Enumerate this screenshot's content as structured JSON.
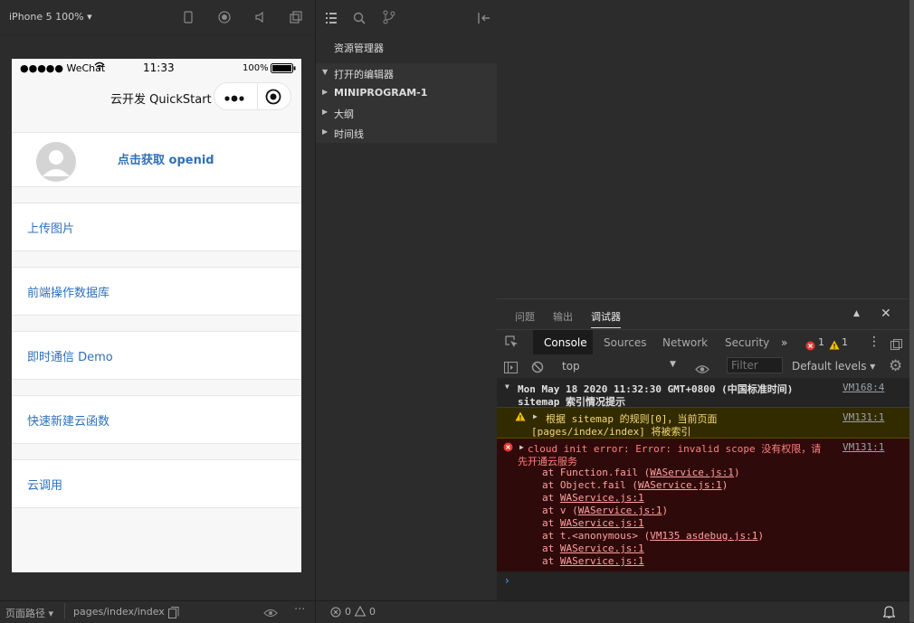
{
  "simulator": {
    "device": "iPhone 5 100% ▾",
    "status": {
      "carrier": "●●●●● WeChat",
      "time": "11:33",
      "battery": "100%"
    },
    "nav_title": "云开发 QuickStart",
    "openid_label": "点击获取 openid",
    "menu": [
      "上传图片",
      "前端操作数据库",
      "即时通信 Demo",
      "快速新建云函数",
      "云调用"
    ]
  },
  "explorer": {
    "title": "资源管理器",
    "items": [
      "打开的编辑器",
      "MINIPROGRAM-1",
      "大纲",
      "时间线"
    ]
  },
  "panel": {
    "tabs": [
      "问题",
      "输出",
      "调试器"
    ],
    "devtools_tabs": [
      "Console",
      "Sources",
      "Network",
      "Security"
    ],
    "error_count": "1",
    "warning_count": "1",
    "context": "top",
    "filter_placeholder": "Filter",
    "levels": "Default levels ▾"
  },
  "log": {
    "group_header": "Mon May 18 2020 11:32:30 GMT+0800 (中国标准时间)",
    "group_subtitle": "sitemap 索引情况提示",
    "group_source": "VM168:4",
    "warn_line1": "根据 sitemap 的规则[0]，当前页面",
    "warn_line2": "[pages/index/index] 将被索引",
    "warn_source": "VM131:1",
    "error_line1": "cloud init error:  Error: invalid scope 没有权限，请",
    "error_line2": "先开通云服务",
    "error_source": "VM131:1",
    "stack": [
      {
        "prefix": "at Function.fail (",
        "file": "WAService.js:1",
        "suffix": ")"
      },
      {
        "prefix": "at Object.fail (",
        "file": "WAService.js:1",
        "suffix": ")"
      },
      {
        "prefix": "at ",
        "file": "WAService.js:1",
        "suffix": ""
      },
      {
        "prefix": "at v (",
        "file": "WAService.js:1",
        "suffix": ")"
      },
      {
        "prefix": "at ",
        "file": "WAService.js:1",
        "suffix": ""
      },
      {
        "prefix": "at t.<anonymous> (",
        "file": "VM135 asdebug.js:1",
        "suffix": ")"
      },
      {
        "prefix": "at ",
        "file": "WAService.js:1",
        "suffix": ""
      },
      {
        "prefix": "at ",
        "file": "WAService.js:1",
        "suffix": ""
      }
    ]
  },
  "bottom": {
    "path_label": "页面路径 ▾",
    "path": "pages/index/index",
    "errors": "0",
    "warnings": "0"
  },
  "colors": {
    "link_blue": "#3070b8",
    "error_bg": "#2f0a0a",
    "warn_bg": "#332b00"
  }
}
